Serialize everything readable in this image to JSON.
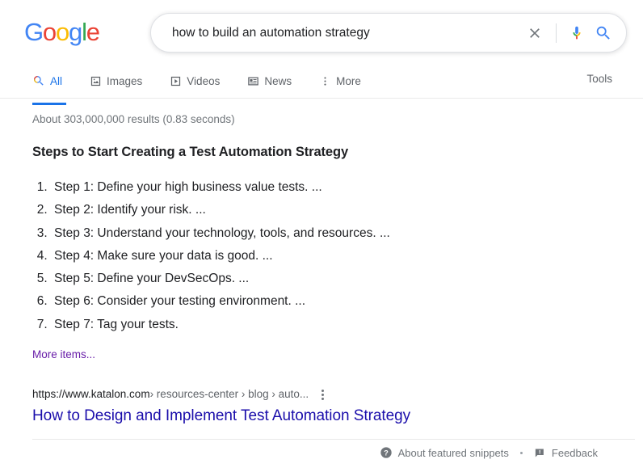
{
  "header": {
    "logo_letters": [
      {
        "char": "G",
        "color": "#4285F4"
      },
      {
        "char": "o",
        "color": "#EA4335"
      },
      {
        "char": "o",
        "color": "#FBBC05"
      },
      {
        "char": "g",
        "color": "#4285F4"
      },
      {
        "char": "l",
        "color": "#34A853"
      },
      {
        "char": "e",
        "color": "#EA4335"
      }
    ],
    "search": {
      "query": "how to build an automation strategy",
      "placeholder": "Search",
      "clear_icon": "close-x-icon",
      "mic_icon": "microphone-icon",
      "search_icon": "magnifier-icon"
    }
  },
  "nav": {
    "tabs": [
      {
        "label": "All",
        "icon": "magnifier-icon",
        "active": true
      },
      {
        "label": "Images",
        "icon": "image-icon",
        "active": false
      },
      {
        "label": "Videos",
        "icon": "video-play-icon",
        "active": false
      },
      {
        "label": "News",
        "icon": "newspaper-icon",
        "active": false
      },
      {
        "label": "More",
        "icon": "kebab-menu-icon",
        "active": false
      }
    ],
    "tools_label": "Tools"
  },
  "results": {
    "stats": "About 303,000,000 results (0.83 seconds)",
    "featured_snippet": {
      "heading": "Steps to Start Creating a Test Automation Strategy",
      "steps": [
        "Step 1: Define your high business value tests. ...",
        "Step 2: Identify your risk. ...",
        "Step 3: Understand your technology, tools, and resources. ...",
        "Step 4: Make sure your data is good. ...",
        "Step 5: Define your DevSecOps. ...",
        "Step 6: Consider your testing environment. ...",
        "Step 7: Tag your tests."
      ],
      "more_items_label": "More items...",
      "source": {
        "url_domain": "https://www.katalon.com",
        "url_crumbs": " › resources-center › blog › auto...",
        "title": "How to Design and Implement Test Automation Strategy",
        "menu_icon": "kebab-menu-icon"
      }
    }
  },
  "footer": {
    "about_icon": "question-circle-icon",
    "about_label": "About featured snippets",
    "separator": "•",
    "feedback_icon": "feedback-flag-icon",
    "feedback_label": "Feedback"
  },
  "colors": {
    "link_blue": "#1a0dab",
    "visited_purple": "#681da8",
    "accent_blue": "#1a73e8",
    "text_primary": "#202124",
    "text_secondary": "#70757a"
  }
}
